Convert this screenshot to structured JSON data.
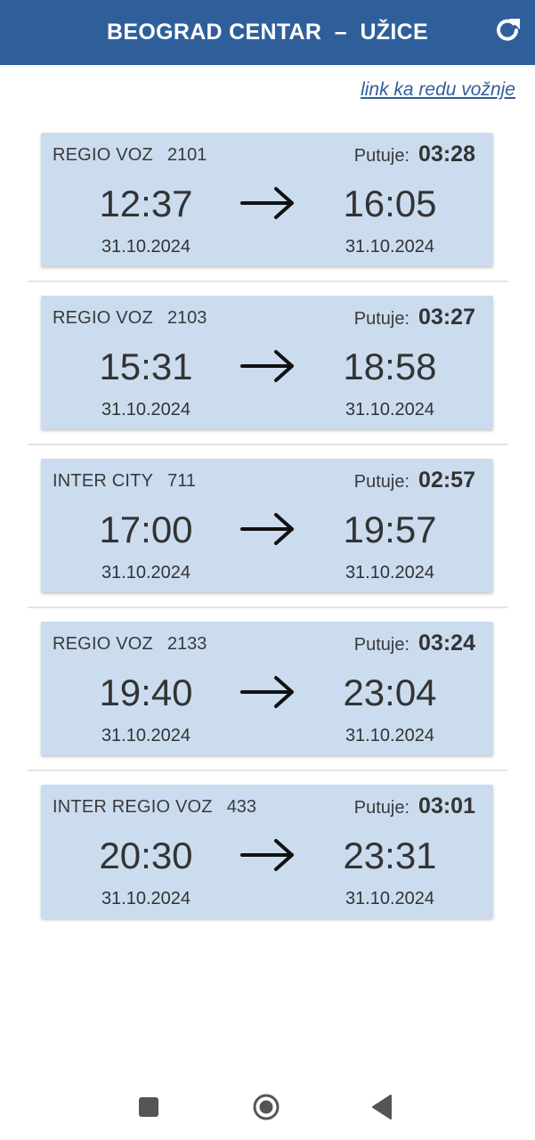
{
  "header": {
    "title": "BEOGRAD CENTAR  –  UŽICE",
    "refresh_icon": "refresh-icon"
  },
  "schedule_link": "link ka redu vožnje",
  "colors": {
    "header_bg": "#2f5f9b",
    "card_bg": "#cbdcef",
    "link": "#2f5f9b"
  },
  "duration_label": "Putuje:",
  "trains": [
    {
      "type": "REGIO VOZ",
      "number": "2101",
      "duration": "03:28",
      "departure_time": "12:37",
      "arrival_time": "16:05",
      "departure_date": "31.10.2024",
      "arrival_date": "31.10.2024"
    },
    {
      "type": "REGIO VOZ",
      "number": "2103",
      "duration": "03:27",
      "departure_time": "15:31",
      "arrival_time": "18:58",
      "departure_date": "31.10.2024",
      "arrival_date": "31.10.2024"
    },
    {
      "type": "INTER CITY",
      "number": "711",
      "duration": "02:57",
      "departure_time": "17:00",
      "arrival_time": "19:57",
      "departure_date": "31.10.2024",
      "arrival_date": "31.10.2024"
    },
    {
      "type": "REGIO VOZ",
      "number": "2133",
      "duration": "03:24",
      "departure_time": "19:40",
      "arrival_time": "23:04",
      "departure_date": "31.10.2024",
      "arrival_date": "31.10.2024"
    },
    {
      "type": "INTER REGIO VOZ",
      "number": "433",
      "duration": "03:01",
      "departure_time": "20:30",
      "arrival_time": "23:31",
      "departure_date": "31.10.2024",
      "arrival_date": "31.10.2024"
    }
  ],
  "navbar": {
    "icons": [
      "recent-apps-icon",
      "home-icon",
      "back-icon"
    ]
  }
}
